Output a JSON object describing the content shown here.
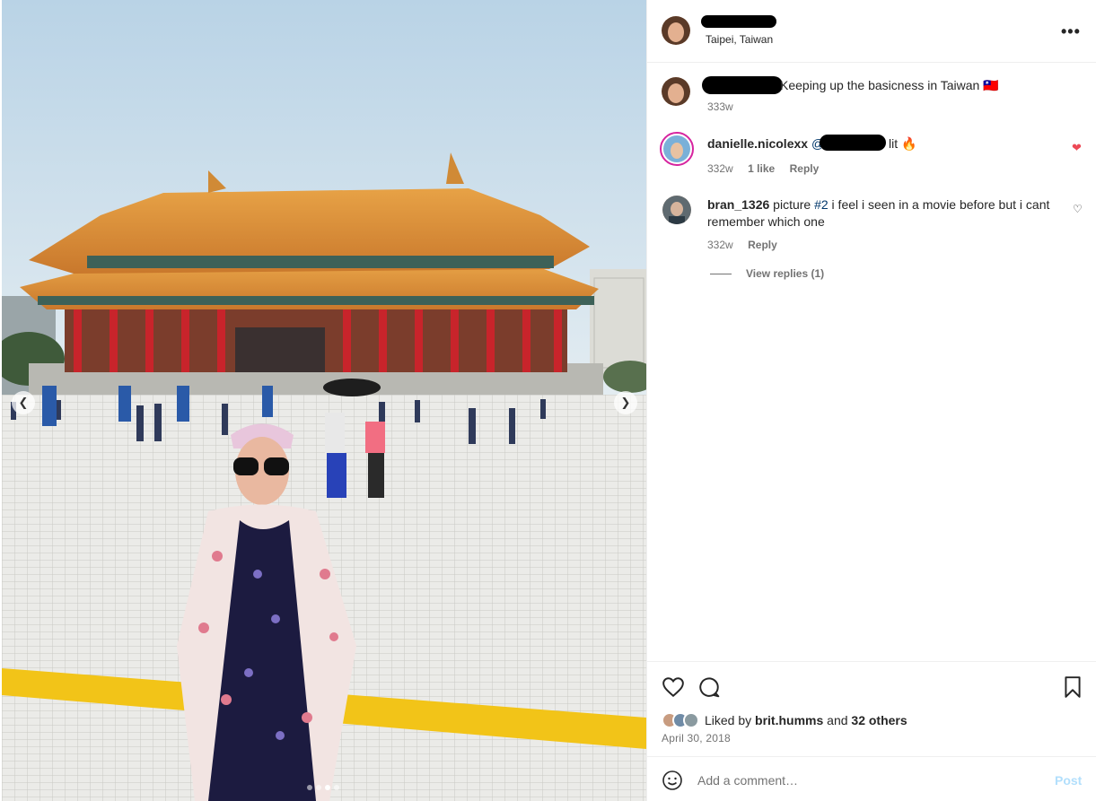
{
  "post": {
    "location": "Taipei, Taiwan",
    "caption_text": "Keeping up the basicness in Taiwan 🇹🇼",
    "caption_time": "333w"
  },
  "comments": [
    {
      "username": "danielle.nicolexx",
      "mention": "@",
      "text": "lit 🔥",
      "time": "332w",
      "likes": "1 like",
      "reply": "Reply",
      "liked": true
    },
    {
      "username": "bran_1326",
      "text_before": "picture ",
      "hashtag": "#2",
      "text_after": " i feel i seen in a movie before but i cant remember which one",
      "time": "332w",
      "reply": "Reply",
      "liked": false
    }
  ],
  "view_replies": "View replies (1)",
  "likes_summary": {
    "prefix": "Liked by ",
    "user": "brit.humms",
    "middle": " and ",
    "others": "32 others"
  },
  "date": "April 30, 2018",
  "add_comment": {
    "placeholder": "Add a comment…",
    "post_label": "Post"
  },
  "icons": {
    "more": "more-options-icon",
    "like": "heart-outline-icon",
    "comment": "comment-bubble-icon",
    "save": "bookmark-icon",
    "emoji": "emoji-smile-icon"
  },
  "colors": {
    "liked_heart": "#ed4956",
    "link": "#00376b",
    "muted": "#737373",
    "post_disabled": "#b2dffc"
  }
}
